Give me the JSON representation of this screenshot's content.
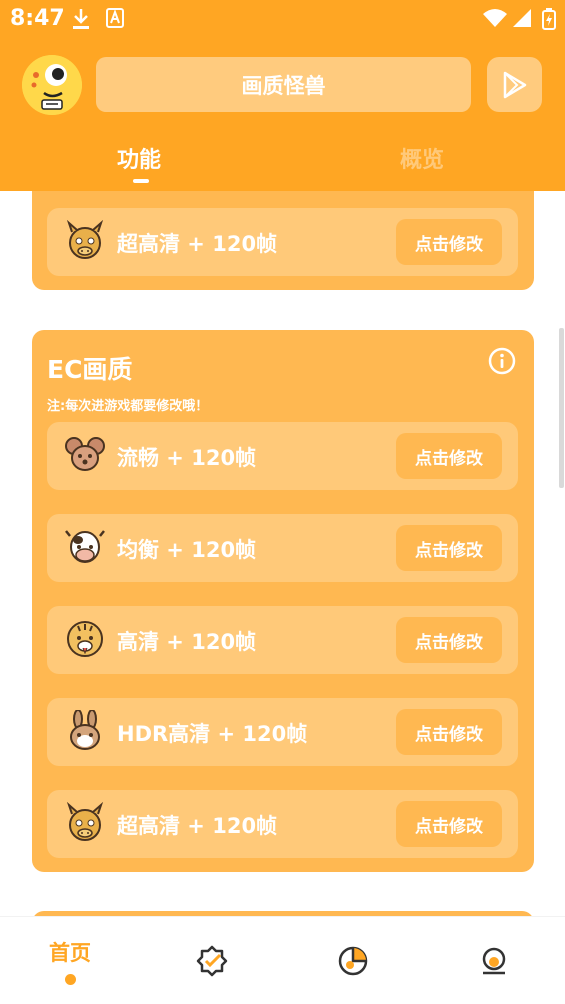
{
  "status_bar": {
    "time": "8:47"
  },
  "header": {
    "title": "画质怪兽",
    "tabs": [
      {
        "label": "功能",
        "active": true
      },
      {
        "label": "概览",
        "active": false
      }
    ]
  },
  "cards": [
    {
      "rows": [
        {
          "icon": "dragon-icon",
          "label": "超高清 + 120帧",
          "button": "点击修改"
        }
      ]
    },
    {
      "title": "EC画质",
      "note": "注:每次进游戏都要修改哦！",
      "rows": [
        {
          "icon": "mouse-icon",
          "label": "流畅 + 120帧",
          "button": "点击修改"
        },
        {
          "icon": "cow-icon",
          "label": "均衡 + 120帧",
          "button": "点击修改"
        },
        {
          "icon": "tiger-icon",
          "label": "高清 + 120帧",
          "button": "点击修改"
        },
        {
          "icon": "rabbit-icon",
          "label": "HDR高清 + 120帧",
          "button": "点击修改"
        },
        {
          "icon": "dragon-icon",
          "label": "超高清 + 120帧",
          "button": "点击修改"
        }
      ]
    }
  ],
  "bottom_nav": {
    "items": [
      {
        "label": "首页",
        "icon": "home",
        "active": true
      },
      {
        "label": "",
        "icon": "badge-check-icon",
        "active": false
      },
      {
        "label": "",
        "icon": "pie-chart-icon",
        "active": false
      },
      {
        "label": "",
        "icon": "profile-icon",
        "active": false
      }
    ]
  },
  "colors": {
    "primary": "#FFA623",
    "card": "#FFB851",
    "row": "#FFC979",
    "tab_inactive": "#FFC97A"
  }
}
